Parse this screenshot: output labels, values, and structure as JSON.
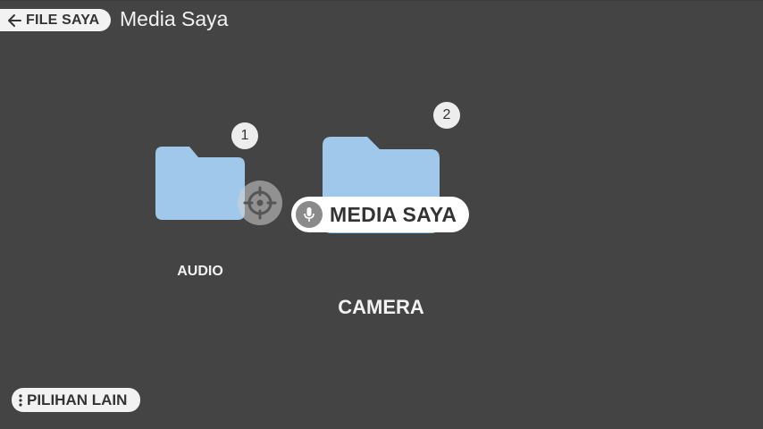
{
  "header": {
    "back_label": "FILE SAYA",
    "title": "Media Saya"
  },
  "folders": [
    {
      "name": "AUDIO",
      "badge": "1"
    },
    {
      "name": "CAMERA",
      "badge": "2"
    }
  ],
  "voice_hint": {
    "text": "MEDIA SAYA"
  },
  "footer": {
    "more_label": "PILIHAN LAIN"
  },
  "colors": {
    "background": "#444444",
    "folder": "#a0c8ea",
    "pill": "#f2f2f2",
    "text_dark": "#333333",
    "text_light": "#f2f2f2"
  },
  "icons": [
    "arrow-left-icon",
    "folder-icon",
    "crosshair-icon",
    "microphone-icon",
    "more-vert-icon"
  ]
}
